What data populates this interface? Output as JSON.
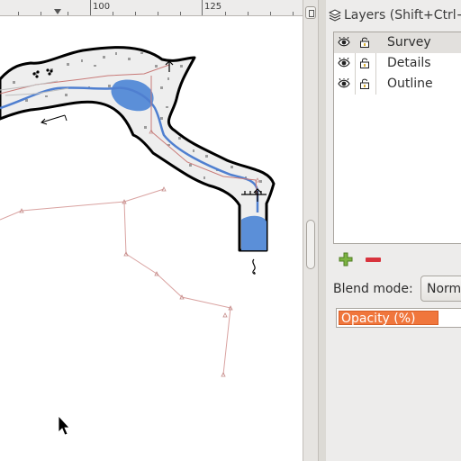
{
  "ruler": {
    "labels": [
      "100",
      "125"
    ]
  },
  "map": {
    "background": "#ffffff",
    "passage_fill": "#eeeeee",
    "water_color": "#5b8fd8",
    "survey_line_color": "#c87a78",
    "wall_color": "#000000"
  },
  "panel": {
    "title": "Layers (Shift+Ctrl+L",
    "layers": [
      {
        "name": "Survey",
        "visible": true,
        "locked": false,
        "selected": true
      },
      {
        "name": "Details",
        "visible": true,
        "locked": false,
        "selected": false
      },
      {
        "name": "Outline",
        "visible": true,
        "locked": false,
        "selected": false
      }
    ],
    "add_icon": "plus-icon",
    "remove_icon": "minus-icon",
    "blend_label": "Blend mode:",
    "blend_value": "Norm",
    "opacity_label": "Opacity (%)",
    "opacity_fraction": 0.76,
    "accent_color": "#f0763c"
  }
}
